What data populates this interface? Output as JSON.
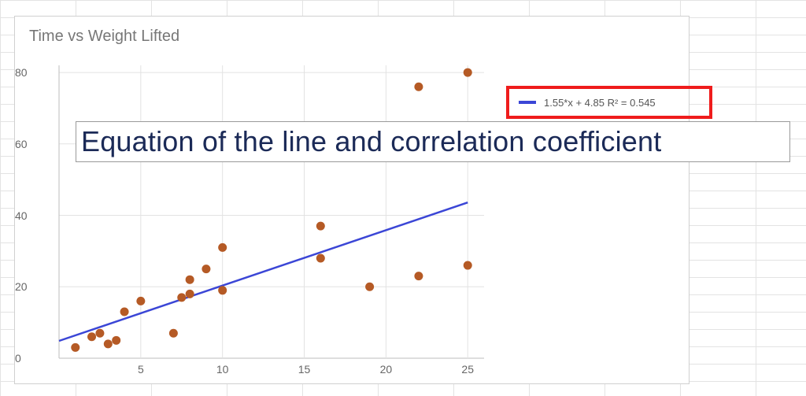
{
  "chart_data": {
    "type": "scatter",
    "title": "Time vs Weight Lifted",
    "xlabel": "",
    "ylabel": "",
    "xlim": [
      0,
      26
    ],
    "ylim": [
      0,
      82
    ],
    "xticks": [
      5,
      10,
      15,
      20,
      25
    ],
    "yticks": [
      0,
      20,
      40,
      60,
      80
    ],
    "series": [
      {
        "name": "points",
        "x": [
          1,
          2,
          2.5,
          3,
          3.5,
          4,
          5,
          7,
          7.5,
          8,
          8,
          9,
          10,
          10,
          16,
          16,
          19,
          22,
          22,
          25,
          25
        ],
        "y": [
          3,
          6,
          7,
          4,
          5,
          13,
          16,
          7,
          17,
          22,
          18,
          25,
          19,
          31,
          28,
          37,
          20,
          23,
          76,
          80,
          26
        ]
      }
    ],
    "trendline": {
      "equation": "1.55*x + 4.85",
      "r2": 0.545,
      "xrange": [
        0,
        25
      ]
    },
    "legend_text": "1.55*x + 4.85 R² = 0.545"
  },
  "annotation": "Equation of the line and correlation coefficient"
}
